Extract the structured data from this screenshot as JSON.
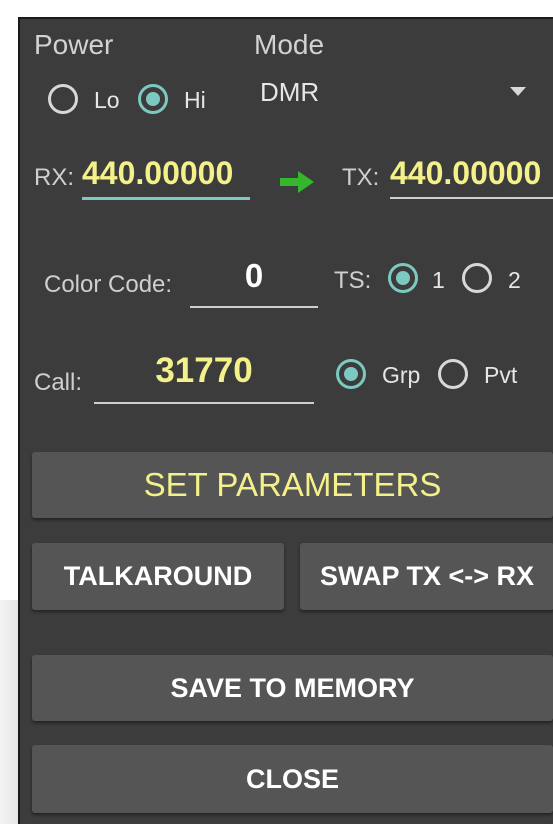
{
  "power": {
    "label": "Power",
    "options": [
      {
        "label": "Lo",
        "selected": false
      },
      {
        "label": "Hi",
        "selected": true
      }
    ]
  },
  "mode": {
    "label": "Mode",
    "selected": "DMR"
  },
  "freq": {
    "rx_label": "RX:",
    "rx_value": "440.00000",
    "tx_label": "TX:",
    "tx_value": "440.00000"
  },
  "color_code": {
    "label": "Color Code:",
    "value": "0"
  },
  "timeslot": {
    "label": "TS:",
    "options": [
      {
        "label": "1",
        "selected": true
      },
      {
        "label": "2",
        "selected": false
      }
    ]
  },
  "call": {
    "label": "Call:",
    "value": "31770",
    "options": [
      {
        "label": "Grp",
        "selected": true
      },
      {
        "label": "Pvt",
        "selected": false
      }
    ]
  },
  "buttons": {
    "set_parameters": "SET PARAMETERS",
    "talkaround": "TALKAROUND",
    "swap": "SWAP TX <-> RX",
    "save": "SAVE TO MEMORY",
    "close": "CLOSE"
  },
  "colors": {
    "background": "#3c3c3c",
    "accent": "#7cc9c2",
    "value_text": "#f4f08a",
    "arrow": "#35b62c",
    "button": "#555555"
  },
  "icons": {
    "dropdown": "triangle-down",
    "arrow": "right-arrow"
  }
}
